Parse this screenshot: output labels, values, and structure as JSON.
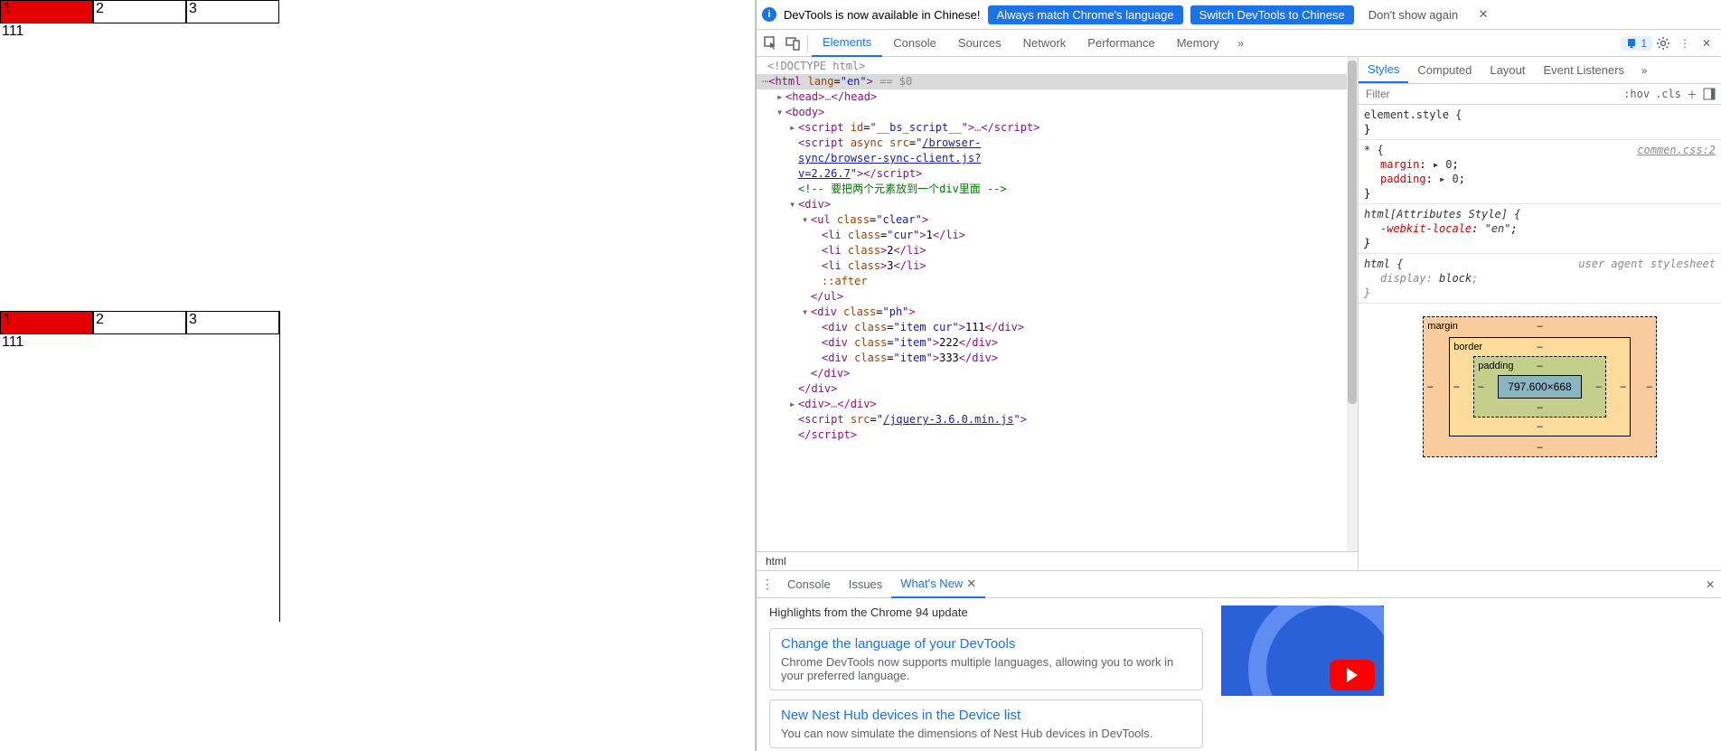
{
  "page": {
    "tabs1": [
      {
        "label": "1",
        "cur": true
      },
      {
        "label": "2",
        "cur": false
      },
      {
        "label": "3",
        "cur": false
      }
    ],
    "content1": "111",
    "tabs2": [
      {
        "label": "1",
        "cur": true
      },
      {
        "label": "2",
        "cur": false
      },
      {
        "label": "3",
        "cur": false
      }
    ],
    "content2": "111"
  },
  "infobar": {
    "text": "DevTools is now available in Chinese!",
    "btn1": "Always match Chrome's language",
    "btn2": "Switch DevTools to Chinese",
    "btn3": "Don't show again"
  },
  "toolbar": {
    "tabs": [
      "Elements",
      "Console",
      "Sources",
      "Network",
      "Performance",
      "Memory"
    ],
    "active": "Elements",
    "issues_count": "1"
  },
  "dom": {
    "doctype": "<!DOCTYPE html>",
    "html_open": {
      "tag": "html",
      "attrs": [
        [
          "lang",
          "en"
        ]
      ],
      "suffix": " == $0"
    },
    "head": {
      "tag": "head"
    },
    "body": {
      "tag": "body"
    },
    "script1": {
      "tag": "script",
      "attrs": [
        [
          "id",
          "__bs_script__"
        ]
      ]
    },
    "script2": {
      "tag": "script",
      "attrs_raw": "async src=",
      "href": "/browser-sync/browser-sync-client.js?v=2.26.7"
    },
    "comment": "<!-- 要把两个元素放到一个div里面 -->",
    "div_open": "div",
    "ul_open": {
      "tag": "ul",
      "attrs": [
        [
          "class",
          "clear"
        ]
      ]
    },
    "li1": {
      "tag": "li",
      "attrs": [
        [
          "class",
          "cur"
        ]
      ],
      "text": "1"
    },
    "li2": {
      "tag": "li",
      "attrs": [
        [
          "class",
          ""
        ]
      ],
      "text": "2"
    },
    "li3": {
      "tag": "li",
      "attrs": [
        [
          "class",
          ""
        ]
      ],
      "text": "3"
    },
    "after": "::after",
    "ul_close": "ul",
    "divph": {
      "tag": "div",
      "attrs": [
        [
          "class",
          "ph"
        ]
      ]
    },
    "item1": {
      "tag": "div",
      "attrs": [
        [
          "class",
          "item cur"
        ]
      ],
      "text": "111"
    },
    "item2": {
      "tag": "div",
      "attrs": [
        [
          "class",
          "item"
        ]
      ],
      "text": "222"
    },
    "item3": {
      "tag": "div",
      "attrs": [
        [
          "class",
          "item"
        ]
      ],
      "text": "333"
    },
    "div_close": "div",
    "div2": {
      "tag": "div"
    },
    "script3": {
      "tag": "script",
      "attrs_raw": "src=",
      "href": "/jquery-3.6.0.min.js"
    },
    "breadcrumb": "html"
  },
  "styles": {
    "tabs": [
      "Styles",
      "Computed",
      "Layout",
      "Event Listeners"
    ],
    "active": "Styles",
    "filter_placeholder": "Filter",
    "hov": ":hov",
    "cls": ".cls",
    "rules": [
      {
        "selector": "element.style {",
        "props": [],
        "close": "}",
        "src": ""
      },
      {
        "selector": "* {",
        "props": [
          [
            "margin",
            "▸ 0"
          ],
          [
            "padding",
            "▸ 0"
          ]
        ],
        "close": "}",
        "src": "commen.css:2"
      },
      {
        "selector": "html[Attributes Style] {",
        "props": [
          [
            "-webkit-locale",
            "\"en\""
          ]
        ],
        "close": "}",
        "src": "",
        "italic": true
      },
      {
        "selector": "html {",
        "props": [
          [
            "display",
            "block"
          ]
        ],
        "close": "}",
        "src": "user agent stylesheet",
        "ua": true
      }
    ],
    "box": {
      "margin_label": "margin",
      "border_label": "border",
      "padding_label": "padding",
      "content": "797.600×668",
      "dash": "–"
    }
  },
  "drawer": {
    "tabs": [
      "Console",
      "Issues",
      "What's New"
    ],
    "active": "What's New",
    "headline": "Highlights from the Chrome 94 update",
    "cards": [
      {
        "title": "Change the language of your DevTools",
        "desc": "Chrome DevTools now supports multiple languages, allowing you to work in your preferred language."
      },
      {
        "title": "New Nest Hub devices in the Device list",
        "desc": "You can now simulate the dimensions of Nest Hub devices in DevTools."
      }
    ]
  }
}
